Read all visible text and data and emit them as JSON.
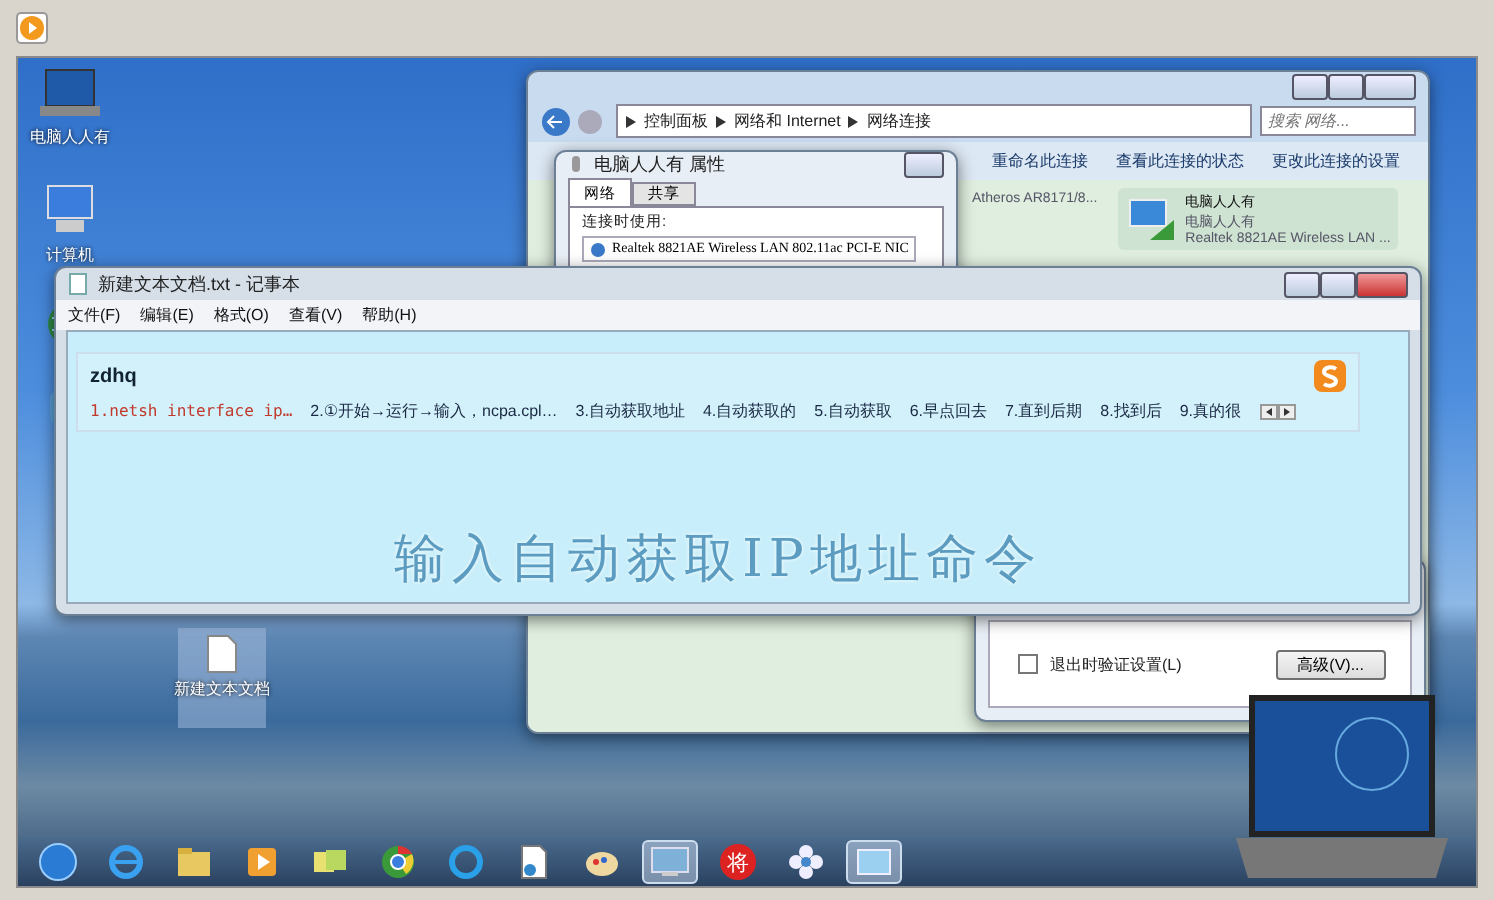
{
  "desktop_icons": [
    {
      "kind": "laptop",
      "label": "电脑人人有"
    },
    {
      "kind": "computer",
      "label": "计算机"
    },
    {
      "kind": "globe"
    },
    {
      "kind": "broadband"
    }
  ],
  "desktop_file": {
    "label": "新建文本文档"
  },
  "explorer": {
    "breadcrumb": [
      "控制面板",
      "网络和 Internet",
      "网络连接"
    ],
    "search": {
      "placeholder": "搜索 网络..."
    },
    "toolbar": [
      "重命名此连接",
      "查看此连接的状态",
      "更改此连接的设置"
    ],
    "connections": [
      {
        "kind": "partial",
        "lines": [
          "Atheros AR8171/8..."
        ]
      },
      {
        "kind": "wireless",
        "lines": [
          "电脑人人有",
          "电脑人人有",
          "Realtek 8821AE Wireless LAN ..."
        ]
      }
    ]
  },
  "properties_dialog": {
    "title": "电脑人人有 属性",
    "tabs": [
      {
        "label": "网络",
        "selected": true
      },
      {
        "label": "共享",
        "selected": false
      }
    ],
    "connect_using": "连接时使用:",
    "adapter": "Realtek 8821AE Wireless LAN 802.11ac PCI-E NIC"
  },
  "advanced_dialog": {
    "checkbox": {
      "label": "退出时验证设置(L)",
      "checked": false
    },
    "button": "高级(V)..."
  },
  "notepad": {
    "title": "新建文本文档.txt - 记事本",
    "menu": [
      "文件(F)",
      "编辑(E)",
      "格式(O)",
      "查看(V)",
      "帮助(H)"
    ],
    "ime": {
      "input": "zdhq",
      "candidates": [
        {
          "text": "1.netsh interface ip…",
          "selected": true
        },
        {
          "text": "2.①开始→运行→输入，ncpa.cpl…",
          "selected": false
        },
        {
          "text": "3.自动获取地址",
          "selected": false
        },
        {
          "text": "4.自动获取的",
          "selected": false
        },
        {
          "text": "5.自动获取",
          "selected": false
        },
        {
          "text": "6.早点回去",
          "selected": false
        },
        {
          "text": "7.直到后期",
          "selected": false
        },
        {
          "text": "8.找到后",
          "selected": false
        },
        {
          "text": "9.真的很",
          "selected": false
        }
      ]
    },
    "caption": "输入自动获取IP地址命令"
  },
  "taskbar": [
    {
      "kind": "start",
      "active": false
    },
    {
      "kind": "browser",
      "active": false
    },
    {
      "kind": "folder",
      "active": false
    },
    {
      "kind": "media",
      "active": false
    },
    {
      "kind": "notes",
      "active": false
    },
    {
      "kind": "chrome",
      "active": false
    },
    {
      "kind": "cloud",
      "active": false
    },
    {
      "kind": "document",
      "active": false
    },
    {
      "kind": "paint",
      "active": false
    },
    {
      "kind": "remote",
      "active": true
    },
    {
      "kind": "chess",
      "active": false,
      "glyph": "将"
    },
    {
      "kind": "flower",
      "active": false
    },
    {
      "kind": "window",
      "active": true
    }
  ]
}
